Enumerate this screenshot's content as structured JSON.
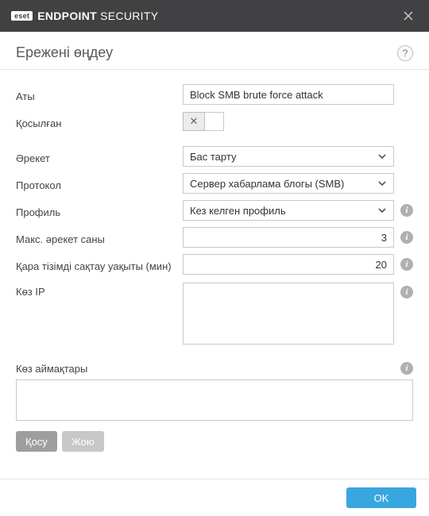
{
  "titlebar": {
    "brand_badge": "eset",
    "brand_main": "ENDPOINT",
    "brand_sub": "SECURITY"
  },
  "header": {
    "title": "Ережені өңдеу",
    "help_glyph": "?"
  },
  "labels": {
    "name": "Аты",
    "enabled": "Қосылған",
    "action": "Әрекет",
    "protocol": "Протокол",
    "profile": "Профиль",
    "max_attempts": "Макс. әрекет саны",
    "block_period": "Қара тізімді сақтау уақыты (мин)",
    "source_ip": "Көз IP",
    "source_zones": "Көз аймақтары"
  },
  "values": {
    "name": "Block SMB brute force attack",
    "enabled": false,
    "action": "Бас тарту",
    "protocol": "Сервер хабарлама блогы (SMB)",
    "profile": "Кез келген профиль",
    "max_attempts": "3",
    "block_period": "20",
    "source_ip": "",
    "source_zones": ""
  },
  "buttons": {
    "add": "Қосу",
    "delete": "Жою",
    "ok": "OK"
  },
  "glyphs": {
    "info": "i",
    "x": "✕"
  }
}
